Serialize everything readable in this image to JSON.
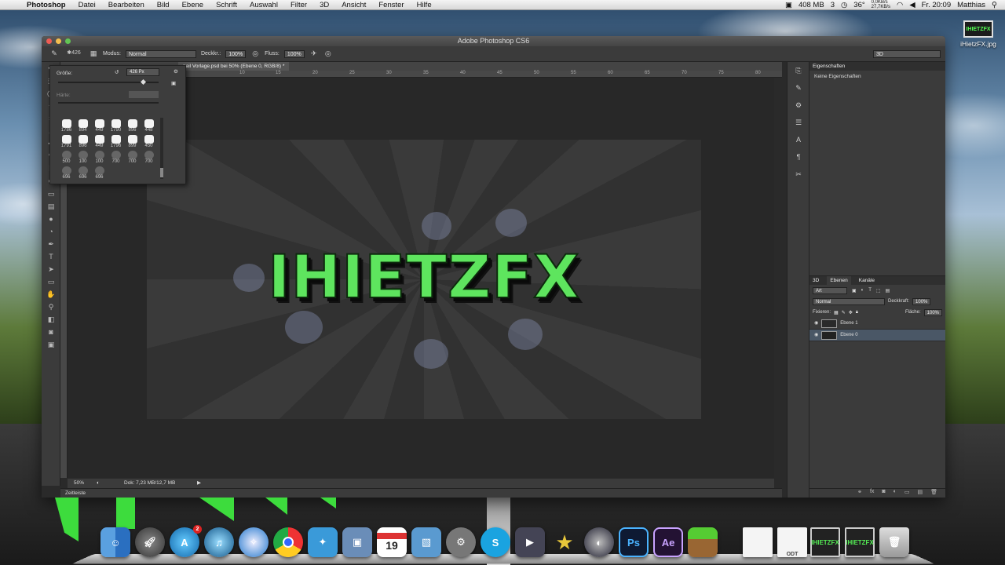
{
  "menubar": {
    "app": "Photoshop",
    "items": [
      "Datei",
      "Bearbeiten",
      "Bild",
      "Ebene",
      "Schrift",
      "Auswahl",
      "Filter",
      "3D",
      "Ansicht",
      "Fenster",
      "Hilfe"
    ],
    "memory": "408 MB",
    "count": "3",
    "temp": "36°",
    "net_up": "0,0KB/s",
    "net_down": "27,7KB/s",
    "time": "Fr. 20:09",
    "user": "Matthias"
  },
  "desktop_file": {
    "thumb": "IHIETZFX",
    "name": "iHietzFX.jpg"
  },
  "window": {
    "title": "Adobe Photoshop CS6"
  },
  "options": {
    "size_value": "426",
    "mode_label": "Modus:",
    "mode_value": "Normal",
    "opacity_label": "Deckkr.:",
    "opacity_value": "100%",
    "flow_label": "Fluss:",
    "flow_value": "100%",
    "workspace": "3D"
  },
  "document_tab": "nail Vorlage.psd bei 50% (Ebene 0, RGB/8) *",
  "ruler": [
    "10",
    "15",
    "20",
    "25",
    "30",
    "35",
    "40",
    "45",
    "50",
    "55",
    "60",
    "65",
    "70",
    "75",
    "80"
  ],
  "brush_panel": {
    "size_label": "Größe:",
    "size_value": "426 Px",
    "hardness_label": "Härte:",
    "tips": [
      "1786",
      "894",
      "449",
      "1790",
      "896",
      "448",
      "1791",
      "896",
      "449",
      "1796",
      "899",
      "450",
      "500",
      "100",
      "100",
      "700",
      "700",
      "700",
      "696",
      "696",
      "696"
    ]
  },
  "artwork_text": "IHIETZFX",
  "status": {
    "zoom": "50%",
    "doc": "Dok: 7,23 MB/12,7 MB"
  },
  "timeline": "Zeitleiste",
  "properties": {
    "title": "Eigenschaften",
    "empty": "Keine Eigenschaften"
  },
  "layers_panel": {
    "tabs": [
      "3D",
      "Ebenen",
      "Kanäle"
    ],
    "filter": "Art",
    "blend": "Normal",
    "opacity_label": "Deckkraft:",
    "opacity": "100%",
    "lock_label": "Fixieren:",
    "fill_label": "Fläche:",
    "fill": "100%",
    "layers": [
      "Ebene 1",
      "Ebene 0"
    ]
  },
  "dock": {
    "apps": [
      "Finder",
      "Launchpad",
      "App Store",
      "iTunes",
      "Safari",
      "Chrome",
      "Twitter",
      "Preview",
      "Calendar",
      "iPhoto",
      "System Preferences",
      "Skype",
      "iMovie",
      "iMovie Star",
      "Cinema 4D",
      "Ps",
      "Ae",
      "Minecraft",
      "Document",
      "ODT",
      "IHIETZFX",
      "IHIETZFX",
      "Trash"
    ],
    "calendar_day": "19",
    "app_store_badge": "2"
  }
}
